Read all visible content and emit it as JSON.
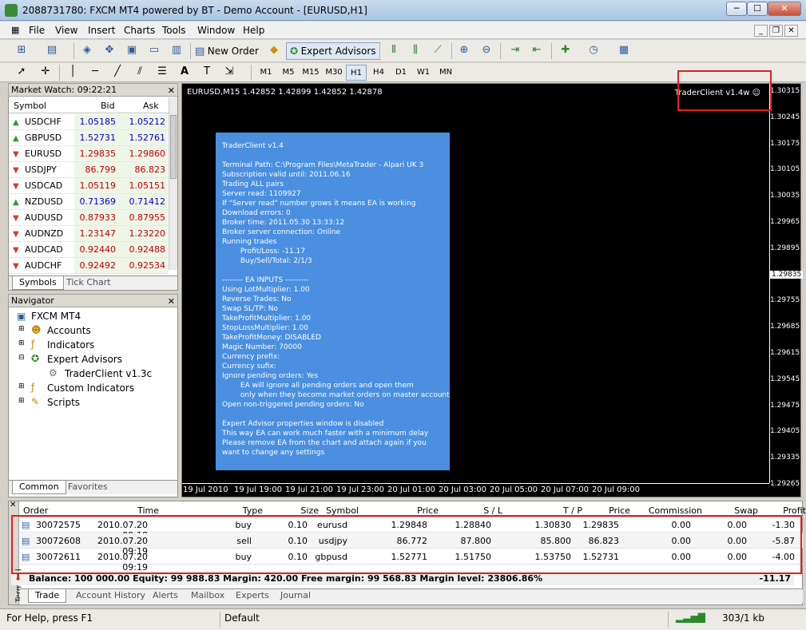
{
  "window": {
    "title": "2088731780: FXCM MT4 powered by BT - Demo Account - [EURUSD,H1]"
  },
  "menu": [
    "File",
    "View",
    "Insert",
    "Charts",
    "Tools",
    "Window",
    "Help"
  ],
  "toolbar": {
    "new_order": "New Order",
    "expert_advisors": "Expert Advisors"
  },
  "timeframes": [
    "M1",
    "M5",
    "M15",
    "M30",
    "H1",
    "H4",
    "D1",
    "W1",
    "MN"
  ],
  "market_watch": {
    "title": "Market Watch: 09:22:21",
    "headers": {
      "symbol": "Symbol",
      "bid": "Bid",
      "ask": "Ask"
    },
    "rows": [
      {
        "symbol": "USDCHF",
        "bid": "1.05185",
        "ask": "1.05212",
        "dir": "up"
      },
      {
        "symbol": "GBPUSD",
        "bid": "1.52731",
        "ask": "1.52761",
        "dir": "up"
      },
      {
        "symbol": "EURUSD",
        "bid": "1.29835",
        "ask": "1.29860",
        "dir": "down"
      },
      {
        "symbol": "USDJPY",
        "bid": "86.799",
        "ask": "86.823",
        "dir": "down"
      },
      {
        "symbol": "USDCAD",
        "bid": "1.05119",
        "ask": "1.05151",
        "dir": "down"
      },
      {
        "symbol": "NZDUSD",
        "bid": "0.71369",
        "ask": "0.71412",
        "dir": "up"
      },
      {
        "symbol": "AUDUSD",
        "bid": "0.87933",
        "ask": "0.87955",
        "dir": "down"
      },
      {
        "symbol": "AUDNZD",
        "bid": "1.23147",
        "ask": "1.23220",
        "dir": "down"
      },
      {
        "symbol": "AUDCAD",
        "bid": "0.92440",
        "ask": "0.92488",
        "dir": "down"
      },
      {
        "symbol": "AUDCHF",
        "bid": "0.92492",
        "ask": "0.92534",
        "dir": "down"
      }
    ],
    "tabs": [
      "Symbols",
      "Tick Chart"
    ]
  },
  "navigator": {
    "title": "Navigator",
    "items": [
      "FXCM MT4",
      "Accounts",
      "Indicators",
      "Expert Advisors",
      "TraderClient v1.3c",
      "Custom Indicators",
      "Scripts"
    ],
    "tabs": [
      "Common",
      "Favorites"
    ]
  },
  "chart": {
    "info": "EURUSD,M15  1.42852 1.42899 1.42852 1.42878",
    "ea_label": "TraderClient v1.4w ☺",
    "y_ticks": [
      "1.30315",
      "1.30245",
      "1.30175",
      "1.30105",
      "1.30035",
      "1.29965",
      "1.29895",
      "1.29835",
      "1.29755",
      "1.29685",
      "1.29615",
      "1.29545",
      "1.29475",
      "1.29405",
      "1.29335",
      "1.29265"
    ],
    "x_ticks": [
      "19 Jul 2010",
      "19 Jul 19:00",
      "19 Jul 21:00",
      "19 Jul 23:00",
      "20 Jul 01:00",
      "20 Jul 03:00",
      "20 Jul 05:00",
      "20 Jul 07:00",
      "20 Jul 09:00"
    ],
    "panel_lines": [
      "TraderClient v1.4",
      "",
      "Terminal Path: C:\\Program Files\\MetaTrader - Alpari UK 3",
      "Subscription valid until: 2011.06.16",
      "Trading ALL pairs",
      "Server read: 1109927",
      "If \"Server read\" number grows it means EA is working",
      "Download errors: 0",
      "Broker time: 2011.05.30 13:33:12",
      "Broker server connection: Online",
      "Running trades",
      "        Profit/Loss: -11.17",
      "        Buy/Sell/Total: 2/1/3",
      "",
      "-------- EA INPUTS ---------",
      "Using LotMultiplier: 1.00",
      "Reverse Trades: No",
      "Swap SL/TP: No",
      "TakeProfitMultiplier: 1.00",
      "StopLossMultiplier: 1.00",
      "TakeProfitMoney: DISABLED",
      "Magic Number: 70000",
      "Currency prefix:",
      "Currency sufix:",
      "Ignore pending orders: Yes",
      "        EA will ignore all pending orders and open them",
      "        only when they become market orders on master account",
      "Open non-triggered pending orders: No",
      "",
      "Expert Advisor properties window is disabled",
      "This way EA can work much faster with a minimum delay",
      "Please remove EA from the chart and attach again if you",
      "want to change any settings"
    ]
  },
  "terminal": {
    "headers": [
      "Order",
      "Time",
      "Type",
      "Size",
      "Symbol",
      "Price",
      "S / L",
      "T / P",
      "Price",
      "Commission",
      "Swap",
      "Profit"
    ],
    "rows": [
      [
        "30072575",
        "2010.07.20 09:18",
        "buy",
        "0.10",
        "eurusd",
        "1.29848",
        "1.28840",
        "1.30830",
        "1.29835",
        "0.00",
        "0.00",
        "-1.30"
      ],
      [
        "30072608",
        "2010.07.20 09:19",
        "sell",
        "0.10",
        "usdjpy",
        "86.772",
        "87.800",
        "85.800",
        "86.823",
        "0.00",
        "0.00",
        "-5.87"
      ],
      [
        "30072611",
        "2010.07.20 09:19",
        "buy",
        "0.10",
        "gbpusd",
        "1.52771",
        "1.51750",
        "1.53750",
        "1.52731",
        "0.00",
        "0.00",
        "-4.00"
      ]
    ],
    "balance": "Balance: 100 000.00  Equity: 99 988.83  Margin: 420.00  Free margin: 99 568.83  Margin level: 23806.86%",
    "total": "-11.17",
    "tabs": [
      "Trade",
      "Account History",
      "Alerts",
      "Mailbox",
      "Experts",
      "Journal"
    ],
    "side_label": "Terminal"
  },
  "status": {
    "help": "For Help, press F1",
    "profile": "Default",
    "traffic": "303/1 kb"
  }
}
